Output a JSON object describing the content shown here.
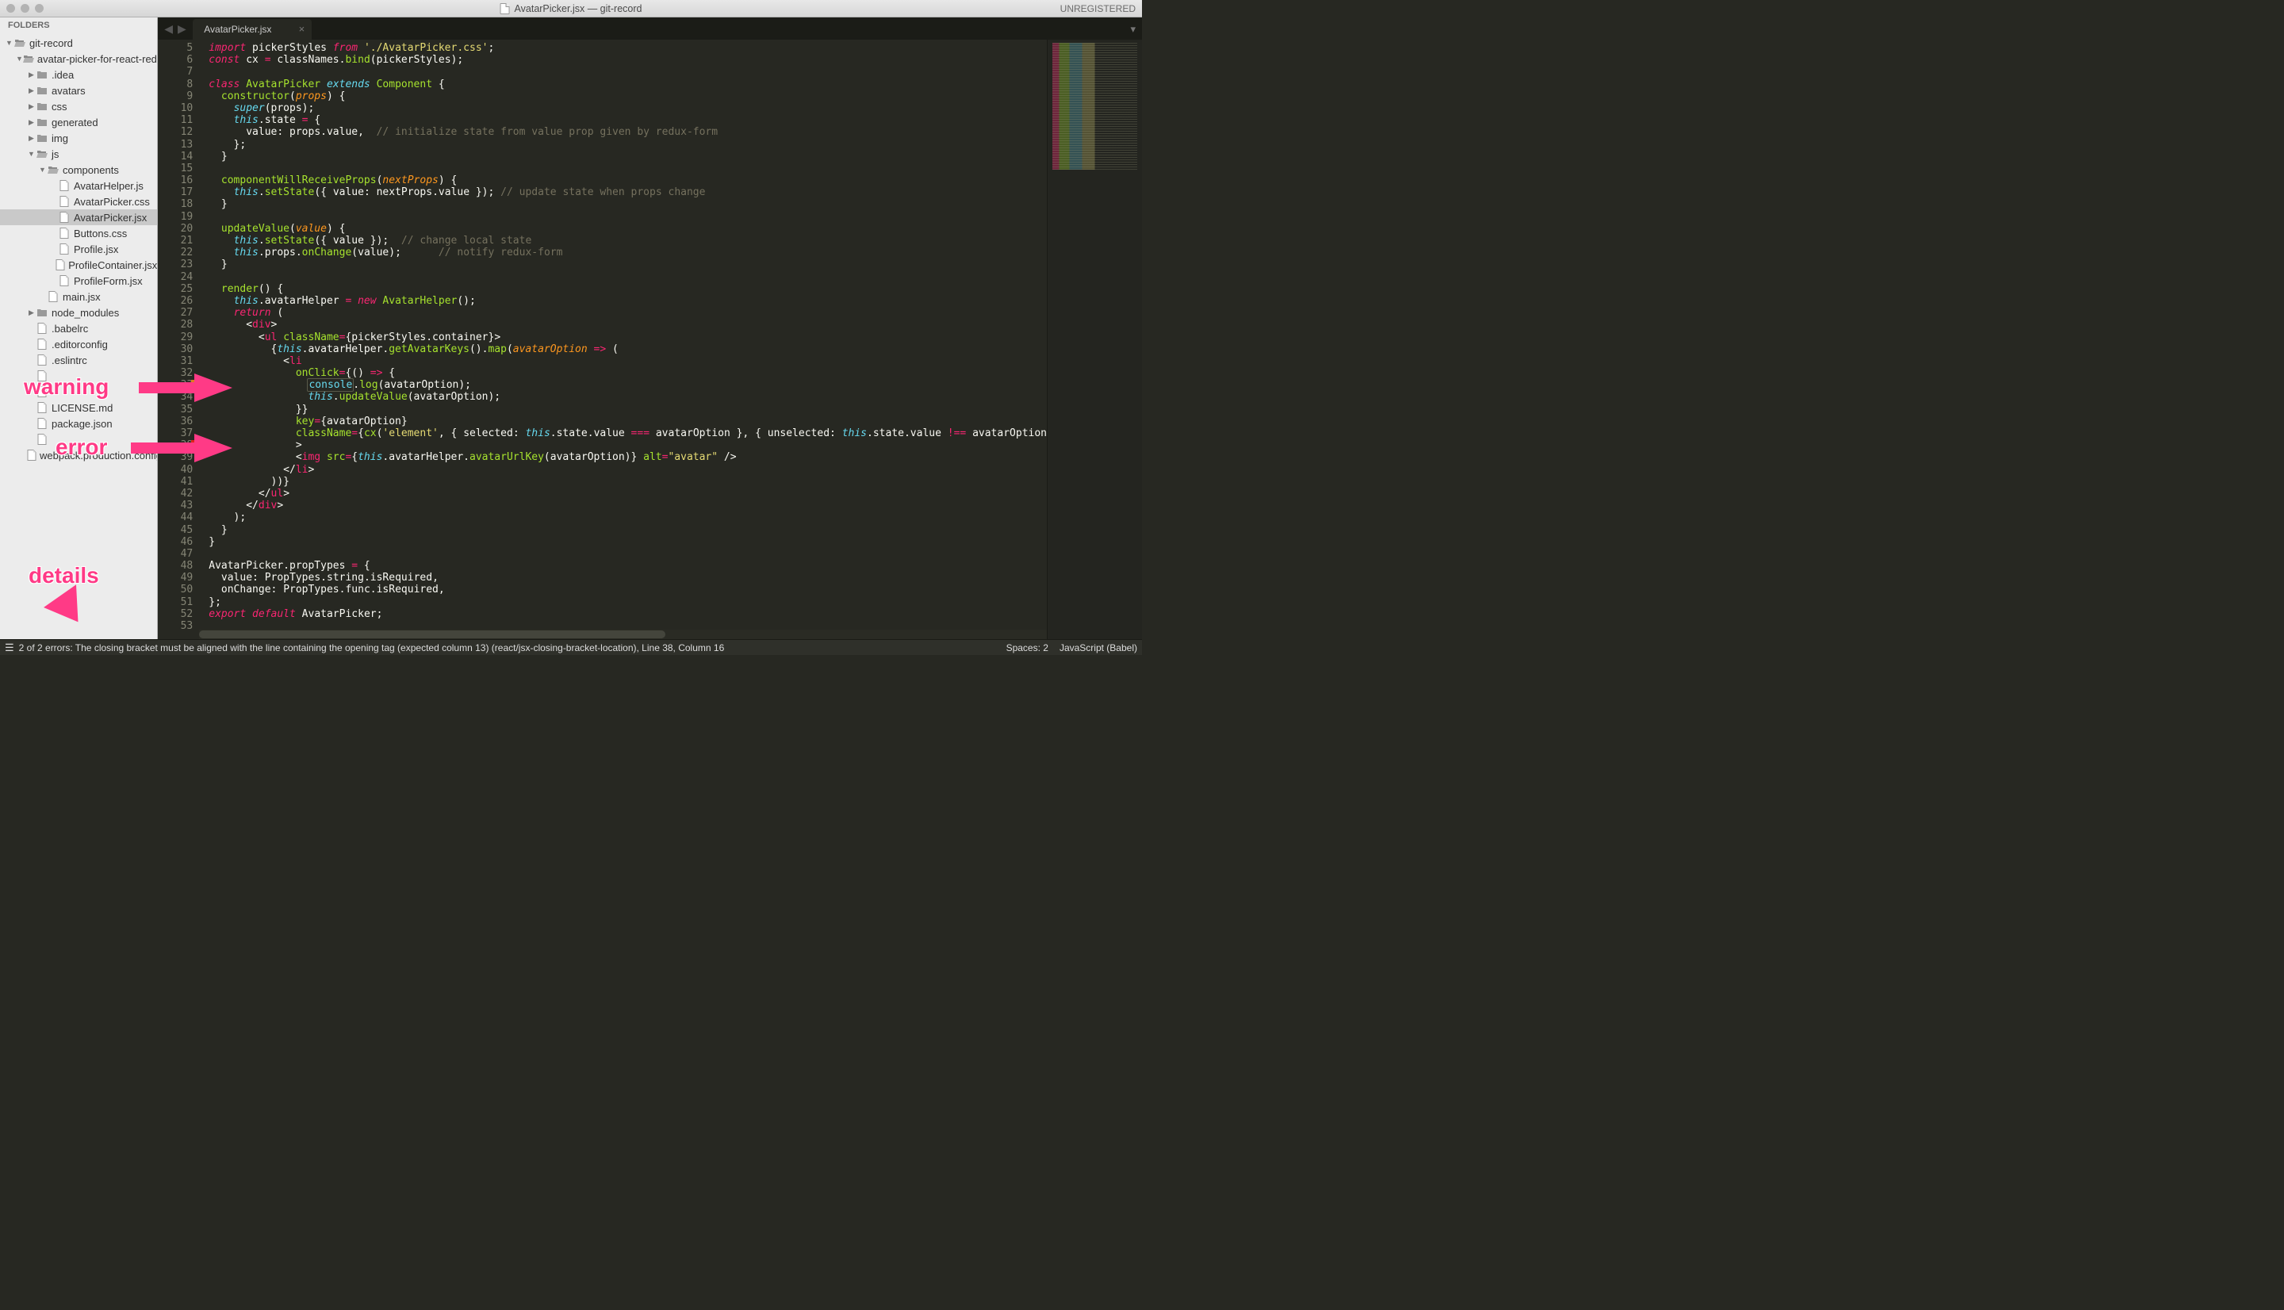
{
  "titlebar": {
    "title": "AvatarPicker.jsx — git-record",
    "registered": "UNREGISTERED"
  },
  "sidebar": {
    "header": "FOLDERS",
    "tree": [
      {
        "d": 0,
        "exp": "open",
        "icon": "folder-open",
        "name": "git-record"
      },
      {
        "d": 1,
        "exp": "open",
        "icon": "folder-open",
        "name": "avatar-picker-for-react-redux-form"
      },
      {
        "d": 2,
        "exp": "closed",
        "icon": "folder",
        "name": ".idea"
      },
      {
        "d": 2,
        "exp": "closed",
        "icon": "folder",
        "name": "avatars"
      },
      {
        "d": 2,
        "exp": "closed",
        "icon": "folder",
        "name": "css"
      },
      {
        "d": 2,
        "exp": "closed",
        "icon": "folder",
        "name": "generated"
      },
      {
        "d": 2,
        "exp": "closed",
        "icon": "folder",
        "name": "img"
      },
      {
        "d": 2,
        "exp": "open",
        "icon": "folder-open",
        "name": "js"
      },
      {
        "d": 3,
        "exp": "open",
        "icon": "folder-open",
        "name": "components"
      },
      {
        "d": 4,
        "exp": null,
        "icon": "file",
        "name": "AvatarHelper.js"
      },
      {
        "d": 4,
        "exp": null,
        "icon": "file",
        "name": "AvatarPicker.css"
      },
      {
        "d": 4,
        "exp": null,
        "icon": "file",
        "name": "AvatarPicker.jsx",
        "sel": true
      },
      {
        "d": 4,
        "exp": null,
        "icon": "file",
        "name": "Buttons.css"
      },
      {
        "d": 4,
        "exp": null,
        "icon": "file",
        "name": "Profile.jsx"
      },
      {
        "d": 4,
        "exp": null,
        "icon": "file",
        "name": "ProfileContainer.jsx"
      },
      {
        "d": 4,
        "exp": null,
        "icon": "file",
        "name": "ProfileForm.jsx"
      },
      {
        "d": 3,
        "exp": null,
        "icon": "file",
        "name": "main.jsx"
      },
      {
        "d": 2,
        "exp": "closed",
        "icon": "folder",
        "name": "node_modules"
      },
      {
        "d": 2,
        "exp": null,
        "icon": "file",
        "name": ".babelrc"
      },
      {
        "d": 2,
        "exp": null,
        "icon": "file",
        "name": ".editorconfig"
      },
      {
        "d": 2,
        "exp": null,
        "icon": "file",
        "name": ".eslintrc"
      },
      {
        "d": 2,
        "exp": null,
        "icon": "file",
        "name": ""
      },
      {
        "d": 2,
        "exp": null,
        "icon": "file",
        "name": ""
      },
      {
        "d": 2,
        "exp": null,
        "icon": "file",
        "name": "LICENSE.md"
      },
      {
        "d": 2,
        "exp": null,
        "icon": "file",
        "name": "package.json"
      },
      {
        "d": 2,
        "exp": null,
        "icon": "file",
        "name": ""
      },
      {
        "d": 2,
        "exp": null,
        "icon": "file",
        "name": "webpack.production.config.js"
      }
    ]
  },
  "tab": {
    "label": "AvatarPicker.jsx",
    "close": "×"
  },
  "code": {
    "first_line": 5,
    "lines": [
      "<span class='k'>import</span> <span class='wht'>pickerStyles</span> <span class='k'>from</span> <span class='s'>'./AvatarPicker.css'</span>;",
      "<span class='k'>const</span> <span class='wht'>cx</span> <span class='op'>=</span> <span class='wht'>classNames</span>.<span class='fn'>bind</span>(<span class='wht'>pickerStyles</span>);",
      "",
      "<span class='k'>class</span> <span class='fn'>AvatarPicker</span> <span class='bl'>extends</span> <span class='fn'>Component</span> {",
      "  <span class='fn'>constructor</span>(<span class='pm'>props</span>) {",
      "    <span class='bl'>super</span>(<span class='wht'>props</span>);",
      "    <span class='bl'>this</span>.<span class='wht'>state</span> <span class='op'>=</span> {",
      "      <span class='wht'>value</span>: <span class='wht'>props</span>.<span class='wht'>value</span>,  <span class='cm'>// initialize state from value prop given by redux-form</span>",
      "    };",
      "  }",
      "",
      "  <span class='fn'>componentWillReceiveProps</span>(<span class='pm'>nextProps</span>) {",
      "    <span class='bl'>this</span>.<span class='fn'>setState</span>({ <span class='wht'>value</span>: <span class='wht'>nextProps</span>.<span class='wht'>value</span> }); <span class='cm'>// update state when props change</span>",
      "  }",
      "",
      "  <span class='fn'>updateValue</span>(<span class='pm'>value</span>) {",
      "    <span class='bl'>this</span>.<span class='fn'>setState</span>({ <span class='wht'>value</span> });  <span class='cm'>// change local state</span>",
      "    <span class='bl'>this</span>.<span class='wht'>props</span>.<span class='fn'>onChange</span>(<span class='wht'>value</span>);      <span class='cm'>// notify redux-form</span>",
      "  }",
      "",
      "  <span class='fn'>render</span>() {",
      "    <span class='bl'>this</span>.<span class='wht'>avatarHelper</span> <span class='op'>=</span> <span class='k'>new</span> <span class='fn'>AvatarHelper</span>();",
      "    <span class='k'>return</span> (",
      "      &lt;<span class='kr'>div</span>&gt;",
      "        &lt;<span class='kr'>ul</span> <span class='fn'>className</span><span class='op'>=</span>{<span class='wht'>pickerStyles</span>.<span class='wht'>container</span>}&gt;",
      "          {<span class='bl'>this</span>.<span class='wht'>avatarHelper</span>.<span class='fn'>getAvatarKeys</span>().<span class='fn'>map</span>(<span class='pm'>avatarOption</span> <span class='op'>=&gt;</span> (",
      "            &lt;<span class='kr'>li</span>",
      "              <span class='fn'>onClick</span><span class='op'>=</span>{() <span class='op'>=&gt;</span> {",
      "                <span class='outline'><span class='blr'>console</span></span>.<span class='fn'>log</span>(<span class='wht'>avatarOption</span>);",
      "                <span class='bl'>this</span>.<span class='fn'>updateValue</span>(<span class='wht'>avatarOption</span>);",
      "              }}",
      "              <span class='fn'>key</span><span class='op'>=</span>{<span class='wht'>avatarOption</span>}",
      "              <span class='fn'>className</span><span class='op'>=</span>{<span class='fn'>cx</span>(<span class='s'>'element'</span>, { <span class='wht'>selected</span>: <span class='bl'>this</span>.<span class='wht'>state</span>.<span class='wht'>value</span> <span class='op'>===</span> <span class='wht'>avatarOption</span> }, { <span class='wht'>unselected</span>: <span class='bl'>this</span>.<span class='wht'>state</span>.<span class='wht'>value</span> <span class='op'>!==</span> <span class='wht'>avatarOption</span>",
      "              &gt;",
      "              &lt;<span class='kr'>img</span> <span class='fn'>src</span><span class='op'>=</span>{<span class='bl'>this</span>.<span class='wht'>avatarHelper</span>.<span class='fn'>avatarUrlKey</span>(<span class='wht'>avatarOption</span>)} <span class='fn'>alt</span><span class='op'>=</span><span class='s'>\"avatar\"</span> /&gt;",
      "            &lt;/<span class='kr'>li</span>&gt;",
      "          ))}",
      "        &lt;/<span class='kr'>ul</span>&gt;",
      "      &lt;/<span class='kr'>div</span>&gt;",
      "    );",
      "  }",
      "}",
      "",
      "<span class='wht'>AvatarPicker</span>.<span class='wht'>propTypes</span> <span class='op'>=</span> {",
      "  <span class='wht'>value</span>: <span class='wht'>PropTypes</span>.<span class='wht'>string</span>.<span class='wht'>isRequired</span>,",
      "  <span class='wht'>onChange</span>: <span class='wht'>PropTypes</span>.<span class='wht'>func</span>.<span class='wht'>isRequired</span>,",
      "};",
      "<span class='k'>export</span> <span class='k'>default</span> <span class='wht'>AvatarPicker</span>;",
      ""
    ],
    "markers": {
      "warning": 33,
      "error": 38
    }
  },
  "status": {
    "left": "2 of 2 errors: The closing bracket must be aligned with the line containing the opening tag (expected column 13) (react/jsx-closing-bracket-location), Line 38, Column 16",
    "spaces": "Spaces: 2",
    "syntax": "JavaScript (Babel)"
  },
  "annotations": {
    "warning": "warning",
    "error": "error",
    "details": "details"
  }
}
